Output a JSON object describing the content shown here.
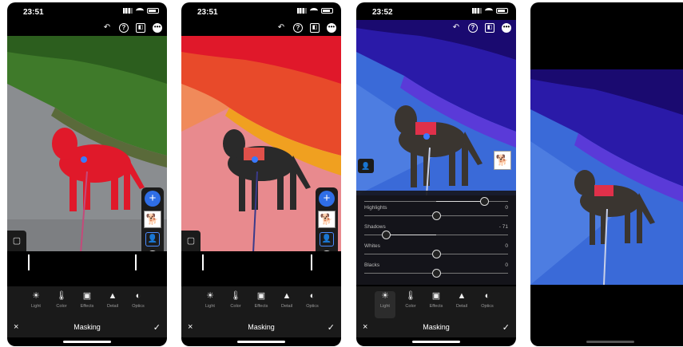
{
  "colors": {
    "accent": "#2f6ee6",
    "mask_red": "#e0192a",
    "mask_orange": "#f0a020",
    "mask_blue": "#2c2cd8"
  },
  "phones": [
    {
      "time": "23:51"
    },
    {
      "time": "23:51"
    },
    {
      "time": "23:52"
    }
  ],
  "toolbar": {
    "tools": [
      "Light",
      "Color",
      "Effects",
      "Detail",
      "Optics"
    ]
  },
  "bottom": {
    "title": "Masking",
    "close_icon": "×",
    "confirm_icon": "✓"
  },
  "light_panel": {
    "sliders": [
      {
        "name": "Highlights",
        "value": "0",
        "level": 0.5
      },
      {
        "name": "Shadows",
        "value": "- 71",
        "level": 0.15
      },
      {
        "name": "Whites",
        "value": "0",
        "level": 0.5
      },
      {
        "name": "Blacks",
        "value": "0",
        "level": 0.5
      }
    ]
  },
  "icons": [
    "undo-icon",
    "help-icon",
    "compare-icon",
    "more-icon",
    "add-mask-icon",
    "person-icon",
    "settings-icon",
    "trash-icon",
    "crop-icon"
  ]
}
